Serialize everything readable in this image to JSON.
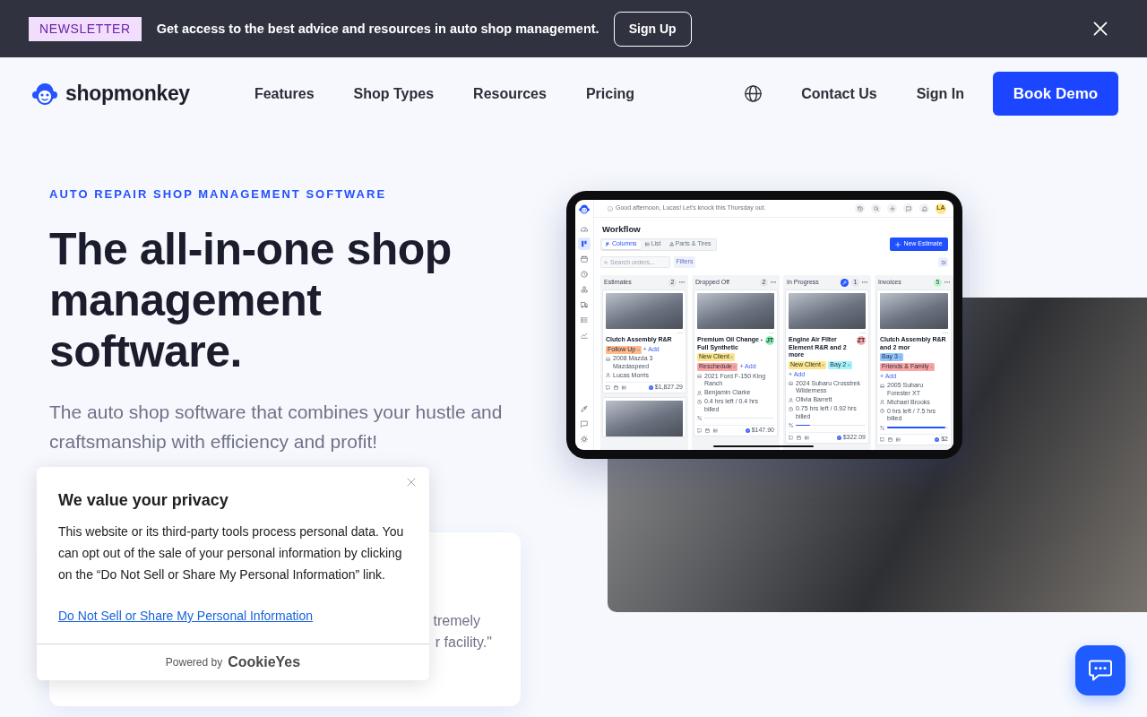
{
  "announcement": {
    "badge": "NEWSLETTER",
    "text": "Get access to the best advice and resources in auto shop management.",
    "button": "Sign Up"
  },
  "nav": {
    "logo": "shopmonkey",
    "links": [
      "Features",
      "Shop Types",
      "Resources",
      "Pricing"
    ],
    "contact": "Contact Us",
    "sign_in": "Sign In",
    "cta": "Book Demo"
  },
  "hero": {
    "eyebrow": "AUTO REPAIR SHOP MANAGEMENT SOFTWARE",
    "title": "The all-in-one shop management software.",
    "subtitle": "The auto shop software that combines your hustle and craftsmanship with efficiency and profit!"
  },
  "app_preview": {
    "greeting": "Good afternoon, Lucas! Let's knock this Thursday out.",
    "avatar": "LA",
    "sidebar": {
      "top": [
        {
          "selected": false
        },
        {
          "selected": true
        },
        {
          "selected": false
        },
        {
          "selected": false
        },
        {
          "selected": false
        },
        {
          "selected": false
        },
        {
          "selected": false
        },
        {
          "selected": false
        }
      ],
      "bottom": [
        {
          "selected": false
        },
        {
          "selected": false
        },
        {
          "selected": false
        }
      ]
    },
    "title": "Workflow",
    "views": [
      {
        "label": "Columns",
        "selected": true
      },
      {
        "label": "List",
        "selected": false
      },
      {
        "label": "Parts & Tires",
        "selected": false
      }
    ],
    "search": {
      "placeholder": "Search orders..."
    },
    "filters": "Filters",
    "new_button": "New Estimate",
    "columns": [
      {
        "title": "Estimates",
        "count": "2",
        "color": "#e5e7eb",
        "badge_icon": false,
        "cards": [
          {
            "kind": "order",
            "title": "Clutch Assembly R&R",
            "tags": [
              {
                "label": "Follow Up",
                "color": "#fdba8c"
              }
            ],
            "add": "+ Add",
            "vehicle": "2008 Mazda 3 Mazdaspeed",
            "customer": "Lucas Morris",
            "total": "$1,827.29"
          },
          {
            "kind": "photo"
          }
        ]
      },
      {
        "title": "Dropped Off",
        "count": "2",
        "color": "#e5e7eb",
        "badge_icon": false,
        "cards": [
          {
            "kind": "order",
            "title": "Premium Oil Change - Full Synthetic",
            "assignee": {
              "initials": "JT",
              "color": "#86efac"
            },
            "tags": [
              {
                "label": "New Client",
                "color": "#fde68a"
              },
              {
                "label": "Reschedule",
                "color": "#fca5a5"
              }
            ],
            "add": "+ Add",
            "vehicle": "2021 Ford F-150 King Ranch",
            "customer": "Benjamin Clarke",
            "hours": "0.4 hrs left / 0.4 hrs billed",
            "level": 0,
            "total": "$147.90"
          }
        ]
      },
      {
        "title": "In Progress",
        "count": "1",
        "color": "#e5e7eb",
        "badge_icon": true,
        "cards": [
          {
            "kind": "order",
            "title": "Engine Air Filter Element R&R and 2 more",
            "assignee": {
              "initials": "ZT",
              "color": "#fca5a5"
            },
            "tags": [
              {
                "label": "New Client",
                "color": "#fde68a"
              },
              {
                "label": "Bay 2",
                "color": "#a5f3fc"
              }
            ],
            "add": "+ Add",
            "vehicle": "2024 Subaru Crosstrek Wilderness",
            "customer": "Olivia Barrett",
            "hours": "0.75 hrs left / 0.92 hrs billed",
            "level": 0.2,
            "total": "$322.09"
          }
        ]
      },
      {
        "title": "Invoices",
        "count": "5",
        "color": "#bbf7d0",
        "badge_icon": false,
        "cards": [
          {
            "kind": "order",
            "title": "Clutch Assembly R&R and 2 mor",
            "tags": [
              {
                "label": "Bay 3",
                "color": "#93c5fd"
              },
              {
                "label": "Friends & Family",
                "color": "#fca5a5"
              }
            ],
            "add": "+ Add",
            "vehicle": "2005 Subaru Forester XT",
            "customer": "Michael Brooks",
            "hours": "0 hrs left / 7.5 hrs billed",
            "level": 0.95,
            "total": "$2"
          }
        ]
      }
    ]
  },
  "testimonial": {
    "lines": [
      "tremely",
      "r facility.\""
    ]
  },
  "cookie": {
    "title": "We value your privacy",
    "body": "This website or its third-party tools process personal data. You can opt out of the sale of your personal information by clicking on the “Do Not Sell or Share My Personal Information” link.",
    "link": "Do Not Sell or Share My Personal Information",
    "powered_by": "Powered by",
    "brand": "CookieYes"
  }
}
